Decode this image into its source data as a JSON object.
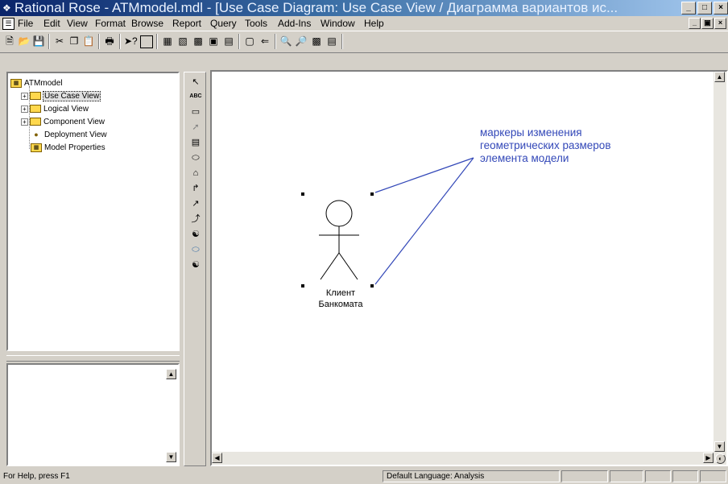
{
  "window": {
    "title": "Rational Rose - ATMmodel.mdl - [Use Case Diagram: Use Case View / Диаграмма вариантов ис...",
    "icon": "rose-app-icon"
  },
  "menu": [
    "File",
    "Edit",
    "View",
    "Format",
    "Browse",
    "Report",
    "Query",
    "Tools",
    "Add-Ins",
    "Window",
    "Help"
  ],
  "toolbar": {
    "icons": [
      "new-icon",
      "open-icon",
      "save-icon",
      "cut-icon",
      "copy-icon",
      "paste-icon",
      "print-icon",
      "context-help-icon",
      "view-doc-icon",
      "browse-class-icon",
      "browse-interaction-icon",
      "browse-component-icon",
      "browse-deployment-icon",
      "browse-parent-icon",
      "browse-previous-icon",
      "back-icon",
      "zoom-in-icon",
      "zoom-out-icon",
      "fit-window-icon",
      "undo-fit-icon"
    ]
  },
  "browser": {
    "root": "ATMmodel",
    "items": [
      {
        "label": "Use Case View",
        "expandable": true,
        "selected": true
      },
      {
        "label": "Logical View",
        "expandable": true,
        "selected": false
      },
      {
        "label": "Component View",
        "expandable": true,
        "selected": false
      },
      {
        "label": "Deployment View",
        "expandable": false,
        "selected": false
      },
      {
        "label": "Model Properties",
        "expandable": false,
        "selected": false
      }
    ]
  },
  "palette": {
    "tools": [
      "selection-arrow",
      "text-box",
      "note",
      "anchor-note",
      "package",
      "use-case",
      "actor",
      "unidirectional-association",
      "dependency",
      "generalization",
      "business-actor",
      "business-use-case",
      "business-worker"
    ],
    "text_tool_label": "ABC"
  },
  "diagram": {
    "actor_name_line1": "Клиент",
    "actor_name_line2": "Банкомата",
    "annotation": [
      "маркеры изменения",
      "геометрических размеров",
      "элемента модели"
    ]
  },
  "status": {
    "help": "For Help, press F1",
    "language": "Default Language: Analysis"
  },
  "colors": {
    "title_gradient_start": "#0a246a",
    "title_gradient_end": "#a6caf0",
    "annotation": "#3348b8",
    "folder": "#ffd84d"
  }
}
